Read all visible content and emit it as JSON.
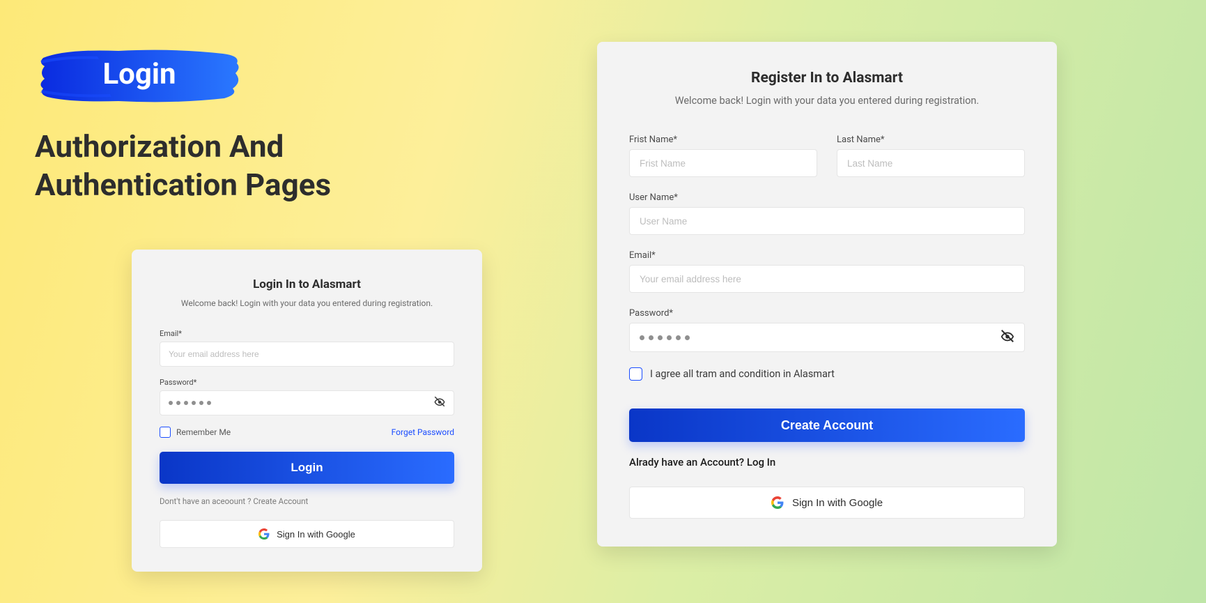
{
  "hero": {
    "brush_label": "Login",
    "heading": "Authorization And Authentication Pages"
  },
  "login": {
    "title": "Login In to Alasmart",
    "subtitle": "Welcome back! Login with your data you entered during registration.",
    "email_label": "Email*",
    "email_placeholder": "Your email address here",
    "password_label": "Password*",
    "remember": "Remember Me",
    "forget": "Forget Password",
    "button": "Login",
    "no_account_text": "Dont't have an aceoount ? ",
    "create_account": "Create Account",
    "google": "Sign In with Google"
  },
  "register": {
    "title": "Register In to Alasmart",
    "subtitle": "Welcome back! Login with your data you entered during registration.",
    "first_label": "Frist Name*",
    "first_placeholder": "Frist Name",
    "last_label": "Last Name*",
    "last_placeholder": "Last Name",
    "user_label": "User Name*",
    "user_placeholder": "User Name",
    "email_label": "Email*",
    "email_placeholder": "Your email address here",
    "password_label": "Password*",
    "agree": "I agree all tram and condition in Alasmart",
    "button": "Create Account",
    "have_account_text": "Alrady have an Account? ",
    "login_link": "Log In",
    "google": "Sign In with Google"
  }
}
